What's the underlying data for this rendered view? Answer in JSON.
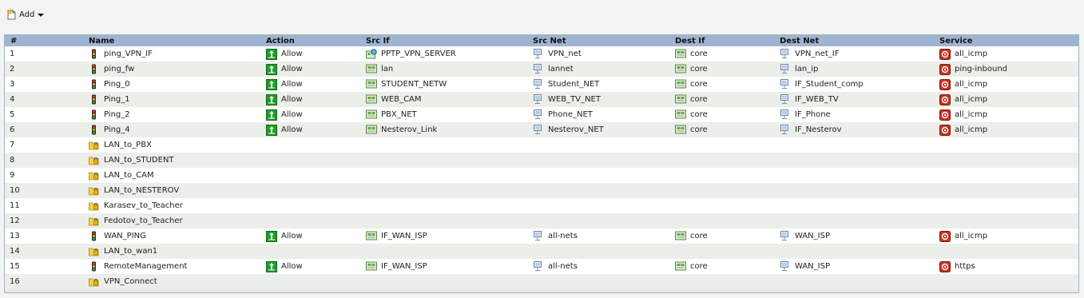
{
  "toolbar": {
    "add_label": "Add"
  },
  "columns": [
    "#",
    "Name",
    "Action",
    "Src If",
    "Src Net",
    "Dest If",
    "Dest Net",
    "Service"
  ],
  "icons": {
    "rule": "traffic-light-icon",
    "folder": "folder-lock-icon",
    "allow": "allow-arrow-icon",
    "interface": "interface-icon",
    "vpn_interface": "vpn-server-icon",
    "network": "network-object-icon",
    "service": "service-icon"
  },
  "colors": {
    "header": "#9fb4d0",
    "allow_green": "#1f9e2a",
    "service_red": "#c8321e"
  },
  "rows": [
    {
      "num": "1",
      "name": "ping_VPN_IF",
      "kind": "rule",
      "action": "Allow",
      "src_if": "PPTP_VPN_SERVER",
      "src_if_kind": "vpn",
      "src_net": "VPN_net",
      "dest_if": "core",
      "dest_net": "VPN_net_IF",
      "service": "all_icmp"
    },
    {
      "num": "2",
      "name": "ping_fw",
      "kind": "rule",
      "action": "Allow",
      "src_if": "lan",
      "src_if_kind": "if",
      "src_net": "lannet",
      "dest_if": "core",
      "dest_net": "lan_ip",
      "service": "ping-inbound"
    },
    {
      "num": "3",
      "name": "Ping_0",
      "kind": "rule",
      "action": "Allow",
      "src_if": "STUDENT_NETW",
      "src_if_kind": "if",
      "src_net": "Student_NET",
      "dest_if": "core",
      "dest_net": "IF_Student_comp",
      "service": "all_icmp"
    },
    {
      "num": "4",
      "name": "Ping_1",
      "kind": "rule",
      "action": "Allow",
      "src_if": "WEB_CAM",
      "src_if_kind": "if",
      "src_net": "WEB_TV_NET",
      "dest_if": "core",
      "dest_net": "IF_WEB_TV",
      "service": "all_icmp"
    },
    {
      "num": "5",
      "name": "Ping_2",
      "kind": "rule",
      "action": "Allow",
      "src_if": "PBX_NET",
      "src_if_kind": "if",
      "src_net": "Phone_NET",
      "dest_if": "core",
      "dest_net": "IF_Phone",
      "service": "all_icmp"
    },
    {
      "num": "6",
      "name": "Ping_4",
      "kind": "rule",
      "action": "Allow",
      "src_if": "Nesterov_Link",
      "src_if_kind": "if",
      "src_net": "Nesterov_NET",
      "dest_if": "core",
      "dest_net": "IF_Nesterov",
      "service": "all_icmp"
    },
    {
      "num": "7",
      "name": "LAN_to_PBX",
      "kind": "folder"
    },
    {
      "num": "8",
      "name": "LAN_to_STUDENT",
      "kind": "folder"
    },
    {
      "num": "9",
      "name": "LAN_to_CAM",
      "kind": "folder"
    },
    {
      "num": "10",
      "name": "LAN_to_NESTEROV",
      "kind": "folder"
    },
    {
      "num": "11",
      "name": "Karasev_to_Teacher",
      "kind": "folder"
    },
    {
      "num": "12",
      "name": "Fedotov_to_Teacher",
      "kind": "folder"
    },
    {
      "num": "13",
      "name": "WAN_PING",
      "kind": "rule",
      "action": "Allow",
      "src_if": "IF_WAN_ISP",
      "src_if_kind": "if",
      "src_net": "all-nets",
      "dest_if": "core",
      "dest_net": "WAN_ISP",
      "service": "all_icmp"
    },
    {
      "num": "14",
      "name": "LAN_to_wan1",
      "kind": "folder"
    },
    {
      "num": "15",
      "name": "RemoteManagement",
      "kind": "rule",
      "action": "Allow",
      "src_if": "IF_WAN_ISP",
      "src_if_kind": "if",
      "src_net": "all-nets",
      "dest_if": "core",
      "dest_net": "WAN_ISP",
      "service": "https"
    },
    {
      "num": "16",
      "name": "VPN_Connect",
      "kind": "folder"
    }
  ]
}
